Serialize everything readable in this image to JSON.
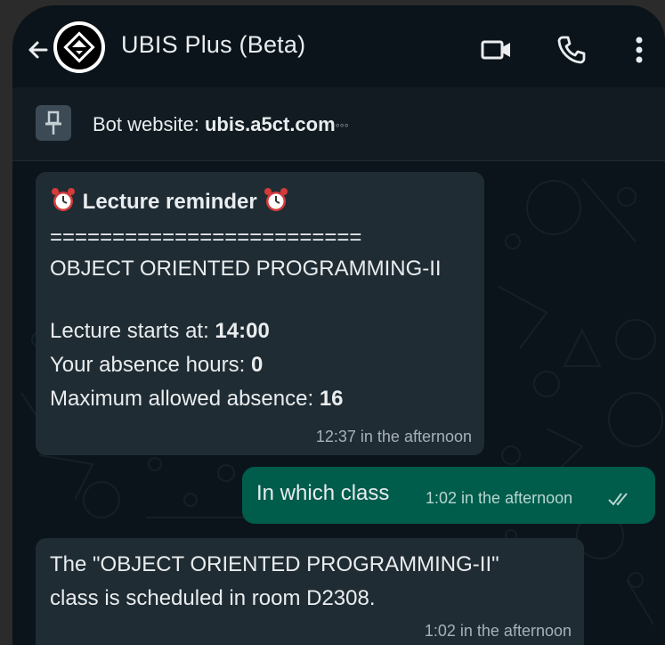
{
  "header": {
    "title": "UBIS Plus (Beta)",
    "icons": [
      "back-arrow-icon",
      "video-call-icon",
      "phone-icon",
      "more-vert-icon"
    ]
  },
  "pinned": {
    "label": "Bot website: ",
    "link": "ubis.a5ct.com",
    "more": "◦◦◦"
  },
  "messages": [
    {
      "direction": "incoming",
      "title": "Lecture reminder",
      "separator": "=========================",
      "course": "OBJECT ORIENTED PROGRAMMING-II",
      "start_label": "Lecture starts at: ",
      "start_value": "14:00",
      "absence_label": "Your absence hours: ",
      "absence_value": "0",
      "max_label": "Maximum allowed absence: ",
      "max_value": "16",
      "time": "12:37 in the afternoon"
    },
    {
      "direction": "outgoing",
      "text": "In which class",
      "time": "1:02 in the afternoon",
      "status": "read"
    },
    {
      "direction": "incoming",
      "line1": "The \"OBJECT ORIENTED PROGRAMMING-II\"",
      "line2": "class is scheduled in room D2308.",
      "time": "1:02 in the afternoon"
    }
  ],
  "colors": {
    "background": "#0b141a",
    "incoming_bubble": "#202c33",
    "outgoing_bubble": "#005c4b",
    "text": "#e9edef",
    "meta": "#a6b1b7"
  }
}
